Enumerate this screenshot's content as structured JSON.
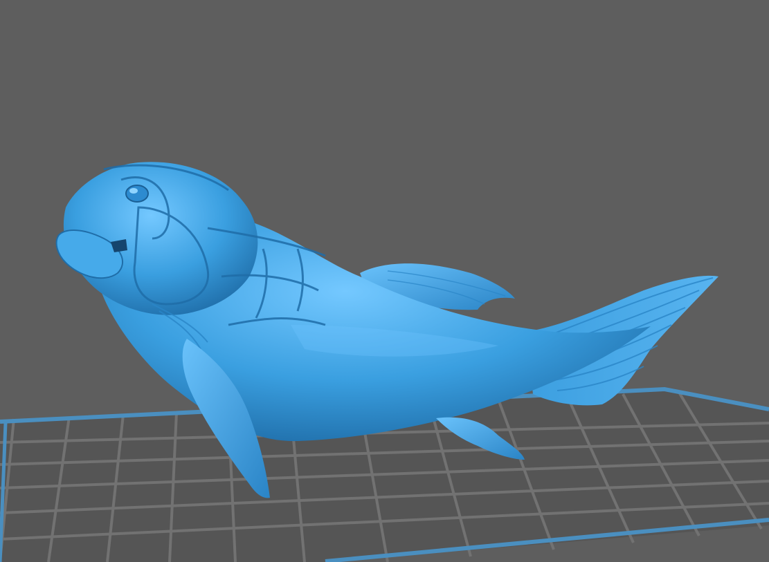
{
  "viewport": {
    "background_color": "#5e5e5e"
  },
  "build_plate": {
    "fill_color": "#555555",
    "grid_line_color": "#727272",
    "border_color": "#4a8fc0"
  },
  "model": {
    "subject": "dunkleosteus-fish",
    "base_color": "#3a9fe0",
    "highlight_color": "#6cc4ff",
    "shadow_color": "#1f6da8"
  }
}
